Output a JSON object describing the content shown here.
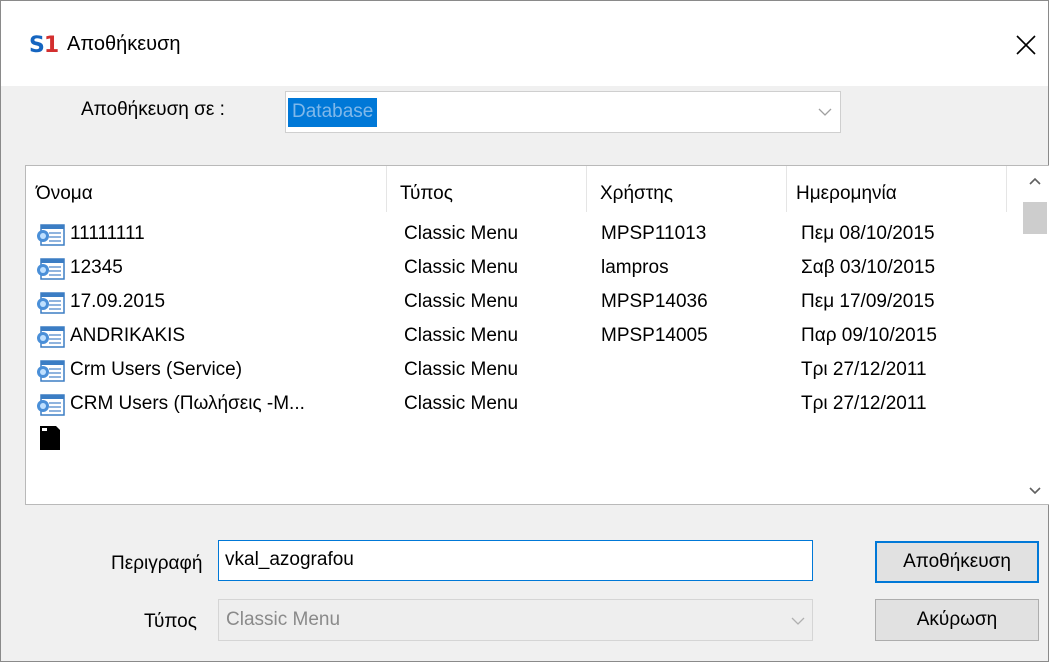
{
  "window": {
    "logo_s": "S",
    "logo_one": "1",
    "title": "Αποθήκευση",
    "close_glyph": "✕"
  },
  "save_in": {
    "label": "Αποθήκευση σε :",
    "value": "Database"
  },
  "columns": [
    "Όνομα",
    "Τύπος",
    "Χρήστης",
    "Ημερομηνία"
  ],
  "rows": [
    {
      "name": "11111111",
      "type": "Classic Menu",
      "user": "MPSP11013",
      "date": "Πεμ 08/10/2015",
      "icon": "menu-file-icon"
    },
    {
      "name": "12345",
      "type": "Classic Menu",
      "user": "lampros",
      "date": "Σαβ 03/10/2015",
      "icon": "menu-file-icon"
    },
    {
      "name": "17.09.2015",
      "type": "Classic Menu",
      "user": "MPSP14036",
      "date": "Πεμ 17/09/2015",
      "icon": "menu-file-icon"
    },
    {
      "name": "ANDRIKAKIS",
      "type": "Classic Menu",
      "user": "MPSP14005",
      "date": "Παρ 09/10/2015",
      "icon": "menu-file-icon"
    },
    {
      "name": "Crm Users (Service)",
      "type": "Classic Menu",
      "user": "",
      "date": "Τρι 27/12/2011",
      "icon": "menu-file-icon"
    },
    {
      "name": "CRM Users (Πωλήσεις -Μ...",
      "type": "Classic Menu",
      "user": "",
      "date": "Τρι 27/12/2011",
      "icon": "menu-file-icon"
    },
    {
      "name": "",
      "type": "",
      "user": "",
      "date": "",
      "icon": "black-document-icon"
    }
  ],
  "description": {
    "label": "Περιγραφή",
    "value": "vkal_azografou"
  },
  "type_field": {
    "label": "Τύπος",
    "value": "Classic Menu"
  },
  "buttons": {
    "save": "Αποθήκευση",
    "cancel": "Ακύρωση"
  },
  "colors": {
    "accent": "#0078d7",
    "logo_blue": "#1565c0",
    "logo_red": "#d32f2f"
  }
}
